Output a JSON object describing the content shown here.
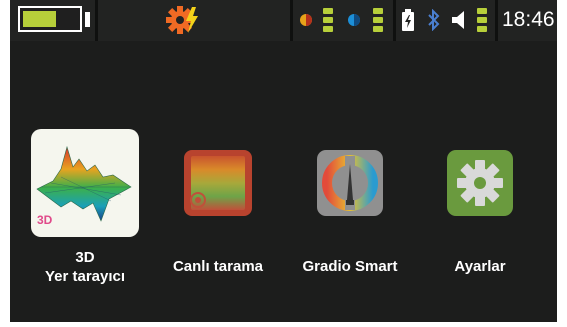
{
  "status_bar": {
    "battery_level": 0.62,
    "battery_color": "#b7cf3a",
    "icons": [
      "battery-icon",
      "settings-warning-icon",
      "brightness-icon",
      "contrast-icon",
      "power-source-icon",
      "bluetooth-icon",
      "volume-icon"
    ],
    "clock": "18:46"
  },
  "apps": [
    {
      "name": "3d-ground-scanner",
      "label_line1": "3D",
      "label_line2": "Yer tarayıcı",
      "badge": "3D",
      "icon": "3d-terrain-icon"
    },
    {
      "name": "live-scan",
      "label_line1": "Canlı tarama",
      "icon": "live-scan-icon"
    },
    {
      "name": "gradio-smart",
      "label_line1": "Gradio Smart",
      "icon": "gradio-dial-icon"
    },
    {
      "name": "settings",
      "label_line1": "Ayarlar",
      "icon": "gear-icon"
    }
  ],
  "colors": {
    "background": "#1c1d1c",
    "status_bar": "#222322",
    "accent_green": "#b7cf3a",
    "settings_tile": "#6a9a3e",
    "live_scan_tile": "#c0503a",
    "gradio_tile": "#8a8a8a"
  }
}
